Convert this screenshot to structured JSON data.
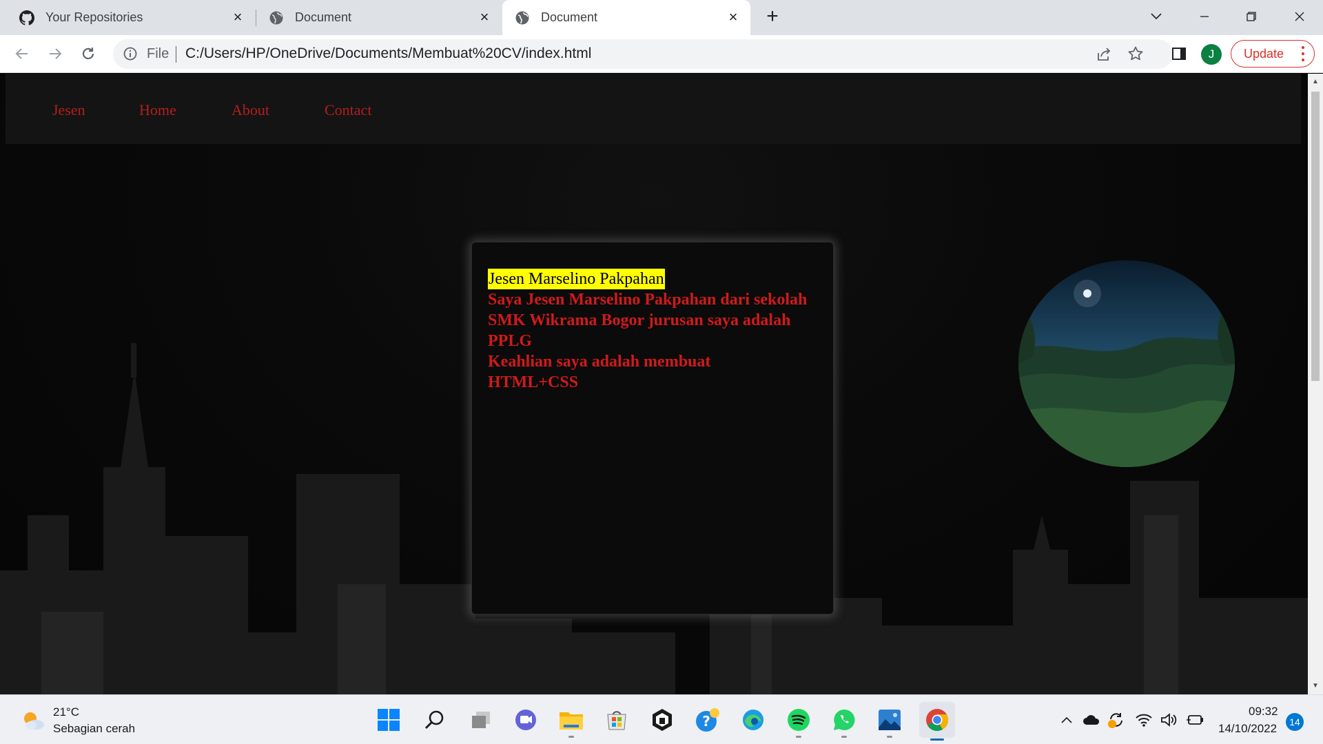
{
  "browser": {
    "tabs": [
      {
        "title": "Your Repositories",
        "icon": "github-icon",
        "active": false
      },
      {
        "title": "Document",
        "icon": "globe-icon",
        "active": false
      },
      {
        "title": "Document",
        "icon": "globe-icon",
        "active": true
      }
    ],
    "address_scheme": "File",
    "address_url": "C:/Users/HP/OneDrive/Documents/Membuat%20CV/index.html",
    "profile_initial": "J",
    "update_label": "Update"
  },
  "page": {
    "nav": [
      "Jesen",
      "Home",
      "About",
      "Contact"
    ],
    "card": {
      "name": "Jesen Marselino Pakpahan",
      "description": "Saya Jesen Marselino Pakpahan dari sekolah SMK Wikrama Bogor jurusan saya adalah PPLG",
      "skills": "Keahlian saya adalah membuat HTML+CSS"
    },
    "colors": {
      "link": "#b51e1e",
      "text": "#d11a1a",
      "highlight": "#ffff00"
    }
  },
  "taskbar": {
    "weather_temp": "21°C",
    "weather_desc": "Sebagian cerah",
    "apps": [
      "start-icon",
      "search-icon",
      "task-view-icon",
      "teams-chat-icon",
      "file-explorer-icon",
      "microsoft-store-icon",
      "app-icon",
      "help-icon",
      "edge-icon",
      "spotify-icon",
      "whatsapp-icon",
      "photos-icon",
      "chrome-icon"
    ],
    "time": "09:32",
    "date": "14/10/2022",
    "notifications": "14"
  }
}
